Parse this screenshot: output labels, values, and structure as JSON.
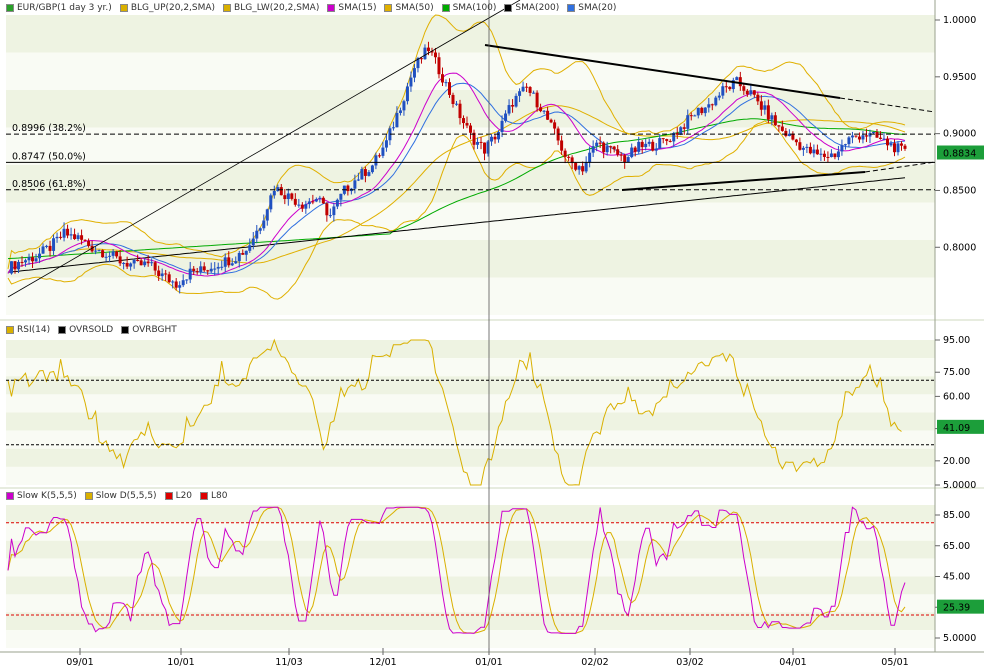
{
  "chart_data": {
    "type": "line",
    "instrument": "EUR/GBP",
    "x_ticks": [
      "09/01",
      "10/01",
      "11/03",
      "12/01",
      "01/01",
      "02/02",
      "03/02",
      "04/01",
      "05/01"
    ],
    "panels": [
      {
        "name": "price",
        "legend": [
          {
            "label": "EUR/GBP(1 day  3 yr.)",
            "color": "#2aa02a"
          },
          {
            "label": "BLG_UP(20,2,SMA)",
            "color": "#d9b000"
          },
          {
            "label": "BLG_LW(20,2,SMA)",
            "color": "#d9b000"
          },
          {
            "label": "SMA(15)",
            "color": "#cc00cc"
          },
          {
            "label": "SMA(50)",
            "color": "#e0b000"
          },
          {
            "label": "SMA(100)",
            "color": "#00aa00"
          },
          {
            "label": "SMA(200)",
            "color": "#000000"
          },
          {
            "label": "SMA(20)",
            "color": "#3070e0"
          }
        ],
        "ylim": [
          0.76,
          1.01
        ],
        "y_ticks": [
          "1.0000",
          "0.9500",
          "0.9000",
          "0.8500",
          "0.8000"
        ],
        "last_value": "0.8834",
        "last_value_num": 0.8834,
        "fib_levels": [
          {
            "label": "0.8996 (38.2%)",
            "value": 0.8996
          },
          {
            "label": "0.8747 (50.0%)",
            "value": 0.8747
          },
          {
            "label": "0.8506 (61.8%)",
            "value": 0.8506
          }
        ],
        "approx_close_path": [
          [
            0,
            0.782
          ],
          [
            4,
            0.788
          ],
          [
            8,
            0.792
          ],
          [
            12,
            0.8
          ],
          [
            16,
            0.812
          ],
          [
            20,
            0.808
          ],
          [
            24,
            0.8
          ],
          [
            28,
            0.795
          ],
          [
            32,
            0.788
          ],
          [
            36,
            0.784
          ],
          [
            40,
            0.785
          ],
          [
            44,
            0.775
          ],
          [
            48,
            0.768
          ],
          [
            52,
            0.778
          ],
          [
            56,
            0.78
          ],
          [
            60,
            0.786
          ],
          [
            64,
            0.79
          ],
          [
            68,
            0.798
          ],
          [
            72,
            0.82
          ],
          [
            76,
            0.853
          ],
          [
            80,
            0.845
          ],
          [
            84,
            0.838
          ],
          [
            88,
            0.843
          ],
          [
            92,
            0.828
          ],
          [
            96,
            0.85
          ],
          [
            100,
            0.862
          ],
          [
            104,
            0.872
          ],
          [
            108,
            0.892
          ],
          [
            112,
            0.925
          ],
          [
            116,
            0.958
          ],
          [
            120,
            0.975
          ],
          [
            124,
            0.95
          ],
          [
            128,
            0.922
          ],
          [
            132,
            0.898
          ],
          [
            136,
            0.886
          ],
          [
            140,
            0.902
          ],
          [
            144,
            0.928
          ],
          [
            148,
            0.94
          ],
          [
            152,
            0.924
          ],
          [
            156,
            0.9
          ],
          [
            160,
            0.875
          ],
          [
            164,
            0.87
          ],
          [
            168,
            0.892
          ],
          [
            172,
            0.885
          ],
          [
            176,
            0.878
          ],
          [
            180,
            0.888
          ],
          [
            184,
            0.89
          ],
          [
            188,
            0.894
          ],
          [
            192,
            0.905
          ],
          [
            196,
            0.918
          ],
          [
            200,
            0.925
          ],
          [
            204,
            0.938
          ],
          [
            208,
            0.945
          ],
          [
            212,
            0.935
          ],
          [
            216,
            0.92
          ],
          [
            220,
            0.905
          ],
          [
            224,
            0.895
          ],
          [
            228,
            0.885
          ],
          [
            232,
            0.88
          ],
          [
            236,
            0.882
          ],
          [
            240,
            0.895
          ],
          [
            244,
            0.9
          ],
          [
            248,
            0.896
          ],
          [
            252,
            0.89
          ],
          [
            256,
            0.883
          ]
        ]
      },
      {
        "name": "rsi",
        "legend": [
          {
            "label": "RSI(14)",
            "color": "#d9b000"
          },
          {
            "label": "OVRSOLD",
            "color": "#000000"
          },
          {
            "label": "OVRBGHT",
            "color": "#000000"
          }
        ],
        "y_ticks": [
          "95.00",
          "75.00",
          "60.00",
          "40.00",
          "20.00",
          "5.0000"
        ],
        "last_value": "41.09",
        "overbought": 70,
        "oversold": 30
      },
      {
        "name": "stochastic",
        "legend": [
          {
            "label": "Slow K(5,5,5)",
            "color": "#cc00cc"
          },
          {
            "label": "Slow D(5,5,5)",
            "color": "#d9b000"
          },
          {
            "label": "L20",
            "color": "#dd0000"
          },
          {
            "label": "L80",
            "color": "#dd0000"
          }
        ],
        "y_ticks": [
          "85.00",
          "65.00",
          "45.00",
          "25.00",
          "5.0000"
        ],
        "last_value": "25.39",
        "l80": 80,
        "l20": 20
      }
    ]
  }
}
